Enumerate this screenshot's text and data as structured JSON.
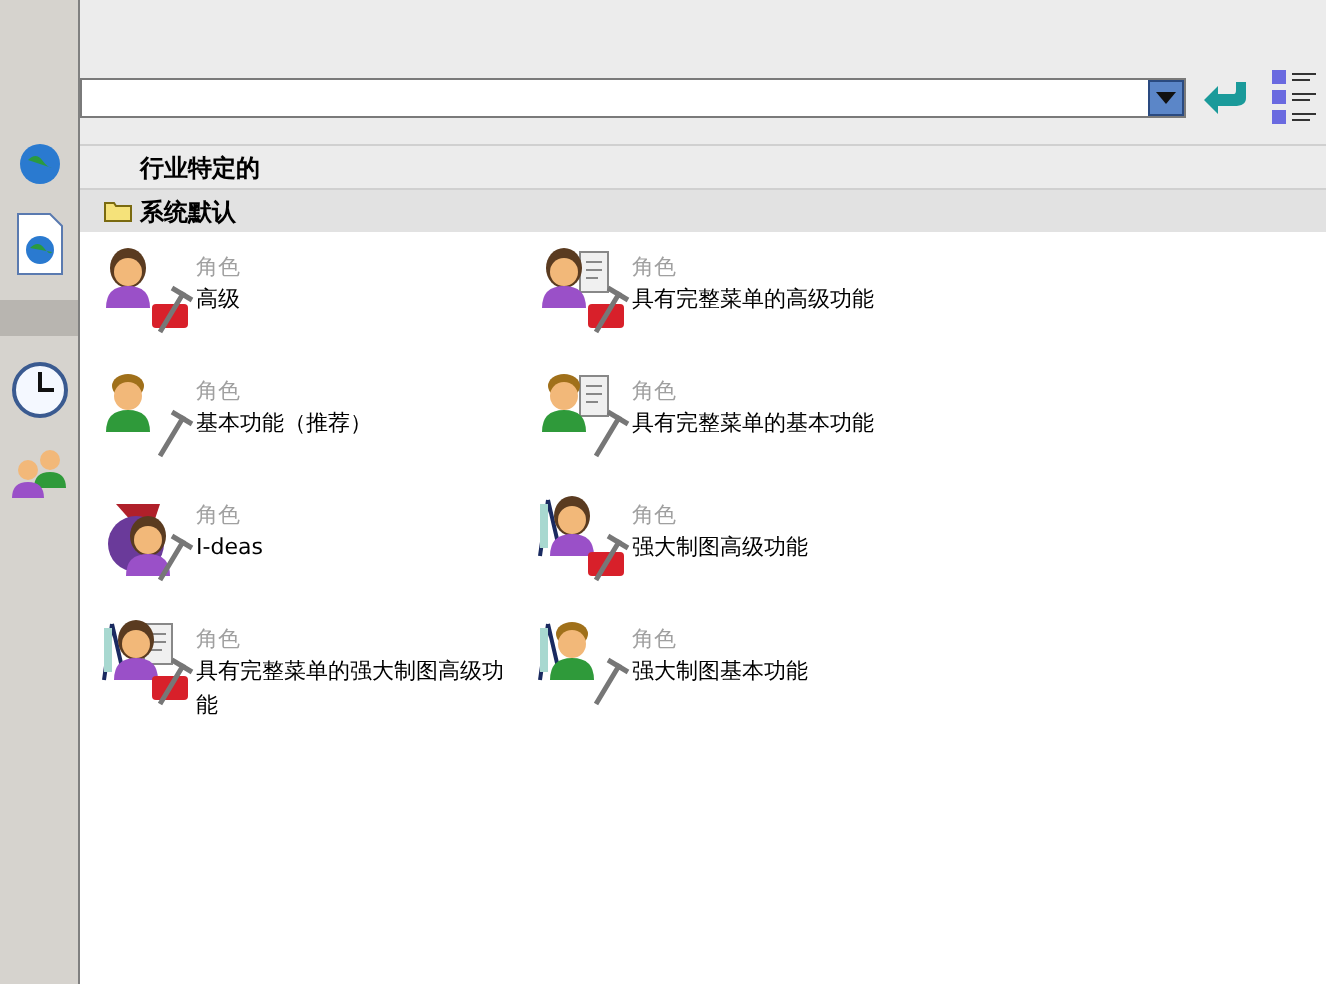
{
  "groups": [
    {
      "label": "行业特定的",
      "expanded": false
    },
    {
      "label": "系统默认",
      "expanded": true
    }
  ],
  "roles": [
    {
      "kind": "advanced",
      "type": "角色",
      "name": "高级"
    },
    {
      "kind": "advanced-menu",
      "type": "角色",
      "name": "具有完整菜单的高级功能"
    },
    {
      "kind": "basic",
      "type": "角色",
      "name": "基本功能（推荐）"
    },
    {
      "kind": "basic-menu",
      "type": "角色",
      "name": "具有完整菜单的基本功能"
    },
    {
      "kind": "ideas",
      "type": "角色",
      "name": "I-deas"
    },
    {
      "kind": "drafting-advanced",
      "type": "角色",
      "name": "强大制图高级功能"
    },
    {
      "kind": "drafting-advanced-menu",
      "type": "角色",
      "name": "具有完整菜单的强大制图高级功能"
    },
    {
      "kind": "drafting-basic",
      "type": "角色",
      "name": "强大制图基本功能"
    }
  ]
}
